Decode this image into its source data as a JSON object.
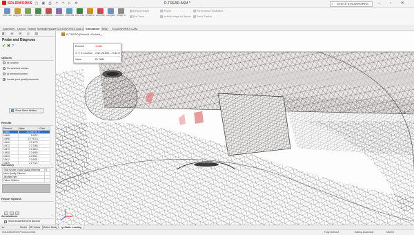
{
  "app": {
    "logo_text": "SOLIDWORKS",
    "document_title": "R-TREAD.ASM *",
    "search_placeholder": "Search SOLIDWORKS"
  },
  "ribbon": {
    "buttons": [
      {
        "label": "New Study",
        "icon": "new-study-icon",
        "color": "#6b8fc7"
      },
      {
        "label": "Apply Material",
        "icon": "material-icon",
        "color": "#c99a3b"
      },
      {
        "label": "Simulation Advisor",
        "icon": "advisor-icon",
        "color": "#7aa35e"
      },
      {
        "label": "Fixtures Advisor",
        "icon": "fixtures-icon",
        "color": "#4e8a4e"
      },
      {
        "label": "External Loads",
        "icon": "loads-icon",
        "color": "#c0504d"
      },
      {
        "label": "Connections Advisor",
        "icon": "connections-icon",
        "color": "#8a6bb5"
      },
      {
        "label": "Shell Manager",
        "icon": "shell-icon",
        "color": "#5a9bb7"
      },
      {
        "label": "Run This Study",
        "icon": "run-icon",
        "color": "#3f7f3f"
      },
      {
        "label": "Results Advisor",
        "icon": "results-icon",
        "color": "#d68a2e"
      },
      {
        "label": "Deformed Result",
        "icon": "deformed-icon",
        "color": "#c94a4a"
      },
      {
        "label": "Compare Results",
        "icon": "compare-icon",
        "color": "#6d8fb8"
      },
      {
        "label": "Design Study",
        "icon": "design-study-icon",
        "color": "#8b8b8b"
      }
    ],
    "small_items": [
      {
        "label": "Design Insight"
      },
      {
        "label": "Plot Tools"
      },
      {
        "label": "Report"
      },
      {
        "label": "Include Image for Report"
      },
      {
        "label": "Performance Evaluation"
      },
      {
        "label": "Trend Tracker"
      }
    ]
  },
  "command_tabs": [
    {
      "label": "Assembly",
      "active": false
    },
    {
      "label": "Layout",
      "active": false
    },
    {
      "label": "Sketch",
      "active": false
    },
    {
      "label": "Markup",
      "active": false
    },
    {
      "label": "Evaluate",
      "active": false
    },
    {
      "label": "SOLIDWORKS Add-Ins",
      "active": false
    },
    {
      "label": "Simulation",
      "active": true
    },
    {
      "label": "MBD",
      "active": false
    },
    {
      "label": "SOLIDWORKS CAM",
      "active": false
    }
  ],
  "panel": {
    "title": "Probe and Diagnose",
    "options_header": "Options",
    "options": [
      {
        "label": "At location",
        "selected": false
      },
      {
        "label": "On selected entities",
        "selected": false
      },
      {
        "label": "At element number",
        "selected": false
      },
      {
        "label": "Locate poor quality elements",
        "selected": true
      }
    ],
    "mesh_button": "Show Mesh Hidden",
    "results_header": "Results",
    "results_columns": [
      "Element",
      "Value",
      "Color"
    ],
    "results_rows": [
      {
        "element": "10480",
        "value": "2.1 0xE+01",
        "selected": true
      },
      {
        "element": "10466",
        "value": "2.0097",
        "selected": false
      },
      {
        "element": "10498",
        "value": "2.0 +4713",
        "selected": false
      },
      {
        "element": "10442",
        "value": "2.0 1279",
        "selected": false
      },
      {
        "element": "10472",
        "value": "2.0 7468",
        "selected": false
      },
      {
        "element": "10479",
        "value": "2.0 4813",
        "selected": false
      },
      {
        "element": "10508",
        "value": "2.0 4980",
        "selected": false
      },
      {
        "element": "10444",
        "value": "2.0 5621",
        "selected": false
      },
      {
        "element": "10512",
        "value": "2.0 0081",
        "selected": false
      },
      {
        "element": "10449",
        "value": "2.0 7721",
        "selected": false
      }
    ],
    "summary_header": "Summary",
    "summary_rows": [
      {
        "label": "Total number of poor quality elements",
        "value": "5"
      },
      {
        "label": "Mesh Quality Criterion",
        "value": ""
      },
      {
        "label": "Jacobian ratio",
        "value": ""
      },
      {
        "label": "Failure Criterion",
        "value": ""
      }
    ],
    "report_header": "Report Options",
    "annotations_header": "Annotations",
    "annotations": [
      {
        "label": "Show Node/Element Number",
        "checked": true
      },
      {
        "label": "Show X,Y,Z location",
        "checked": true
      },
      {
        "label": "Show Value",
        "checked": true
      }
    ]
  },
  "viewport": {
    "breadcrumb": "R-TREAD (Default <Default_...",
    "tooltip": {
      "rows": [
        {
          "key": "Element",
          "value": "10480",
          "key_red": true
        },
        {
          "key": "X, Y, Z Location",
          "value": "2.32, 26.892, -17.84 m",
          "key_red": false
        },
        {
          "key": "Value",
          "value": "21.7884",
          "key_red": false
        }
      ]
    }
  },
  "bottom_tabs": [
    {
      "label": "Model",
      "active": false
    },
    {
      "label": "3D Views",
      "active": false
    },
    {
      "label": "Motion Study 1",
      "active": false
    },
    {
      "label": "Ip-Static Loading",
      "active": true
    }
  ],
  "status": {
    "left": "SOLIDWORKS Premium 2021",
    "fully_defined": "Fully Defined",
    "editing": "Editing Assembly",
    "units": "MMGS"
  },
  "colors": {
    "accent": "#d71920",
    "selection": "#2d6bc4",
    "hotspot": "#e8898c"
  }
}
